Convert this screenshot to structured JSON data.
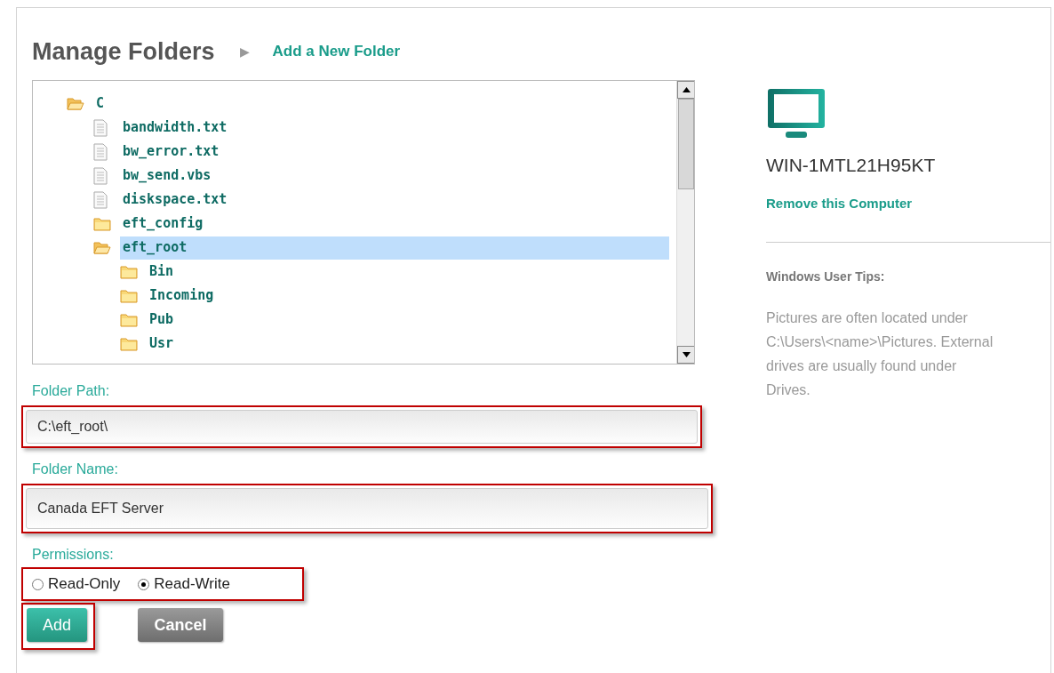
{
  "breadcrumb": {
    "title": "Manage Folders",
    "separator": "▶",
    "link": "Add a New Folder"
  },
  "tree": [
    {
      "name": "C",
      "kind": "folder",
      "expanded": true,
      "selected": false,
      "children": [
        {
          "name": "bandwidth.txt",
          "kind": "file",
          "selected": false
        },
        {
          "name": "bw_error.txt",
          "kind": "file",
          "selected": false
        },
        {
          "name": "bw_send.vbs",
          "kind": "file",
          "selected": false
        },
        {
          "name": "diskspace.txt",
          "kind": "file",
          "selected": false
        },
        {
          "name": "eft_config",
          "kind": "folder",
          "expanded": false,
          "selected": false
        },
        {
          "name": "eft_root",
          "kind": "folder",
          "expanded": true,
          "selected": true,
          "children": [
            {
              "name": "Bin",
              "kind": "folder",
              "expanded": false,
              "selected": false
            },
            {
              "name": "Incoming",
              "kind": "folder",
              "expanded": false,
              "selected": false
            },
            {
              "name": "Pub",
              "kind": "folder",
              "expanded": false,
              "selected": false
            },
            {
              "name": "Usr",
              "kind": "folder",
              "expanded": false,
              "selected": false
            }
          ]
        }
      ]
    }
  ],
  "computer": {
    "name": "WIN-1MTL21H95KT",
    "remove_link": "Remove this Computer"
  },
  "tips": {
    "title": "Windows User Tips:",
    "text": "Pictures are often located under C:\\Users\\<name>\\Pictures. External drives are usually found under Drives."
  },
  "folder_path": {
    "label": "Folder Path:",
    "value": "C:\\eft_root\\",
    "highlighted": true
  },
  "folder_name": {
    "label": "Folder Name:",
    "value": "Canada EFT Server",
    "highlighted": true
  },
  "permissions": {
    "label": "Permissions:",
    "highlighted": true,
    "options": [
      {
        "label": "Read-Only",
        "selected": false
      },
      {
        "label": "Read-Write",
        "selected": true
      }
    ]
  },
  "buttons": [
    {
      "label": "Add",
      "kind": "primary",
      "highlighted": true
    },
    {
      "label": "Cancel",
      "kind": "secondary",
      "highlighted": false
    }
  ]
}
